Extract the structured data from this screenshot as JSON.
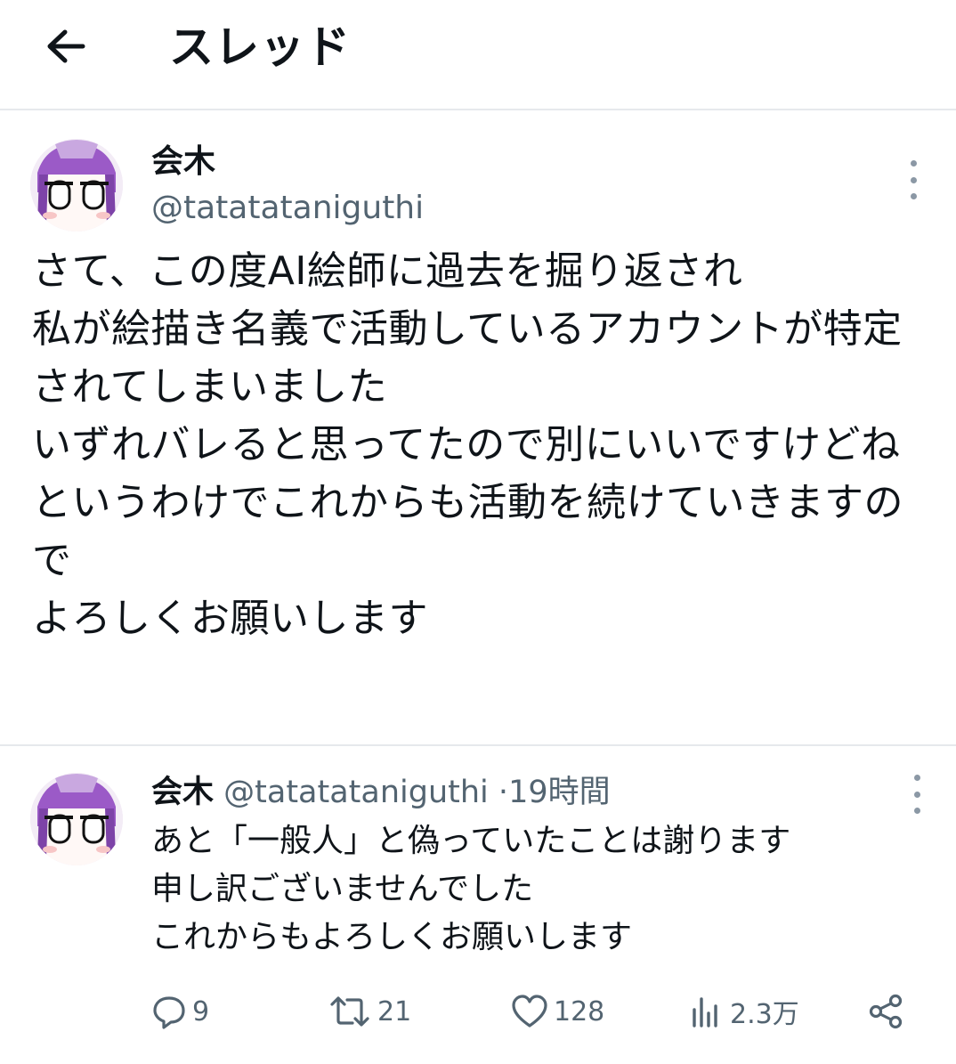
{
  "header": {
    "title": "スレッド",
    "back_icon": "arrow-left-icon"
  },
  "tweet1": {
    "name": "会木",
    "handle": "@tatatataniguthi",
    "body": "さて、この度AI絵師に過去を掘り返され\n私が絵描き名義で活動しているアカウントが特定されてしまいました\nいずれバレると思ってたので別にいいですけどね\nというわけでこれからも活動を続けていきますので\nよろしくお願いします"
  },
  "tweet2": {
    "name": "会木",
    "handle": "@tatatataniguthi",
    "separator": "·",
    "time": "19時間",
    "body": "あと「一般人」と偽っていたことは謝ります\n申し訳ございませんでした\nこれからもよろしくお願いします",
    "actions": {
      "replies": "9",
      "retweets": "21",
      "likes": "128",
      "views": "2.3万"
    }
  },
  "colors": {
    "text": "#0f1419",
    "secondary": "#536471",
    "divider": "#e6e9ec",
    "avatar_hair": "#9b5ac7"
  }
}
